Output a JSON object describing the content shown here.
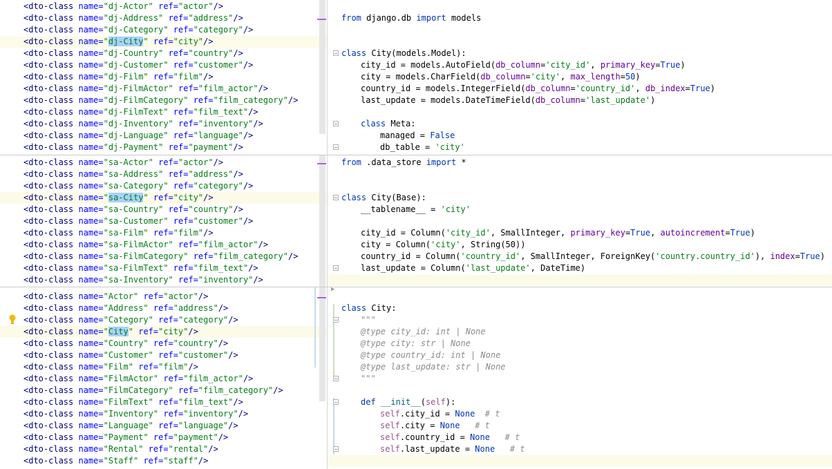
{
  "colors": {
    "selection": "#a6d2ff",
    "highlight_line": "#fcfbe8",
    "mark": "#b65dd6"
  },
  "pane1": {
    "xml_lines": [
      [
        "dj-Actor",
        "actor"
      ],
      [
        "dj-Address",
        "address"
      ],
      [
        "dj-Category",
        "category"
      ],
      [
        "dj-City",
        "city"
      ],
      [
        "dj-Country",
        "country"
      ],
      [
        "dj-Customer",
        "customer"
      ],
      [
        "dj-Film",
        "film"
      ],
      [
        "dj-FilmActor",
        "film_actor"
      ],
      [
        "dj-FilmCategory",
        "film_category"
      ],
      [
        "dj-FilmText",
        "film_text"
      ],
      [
        "dj-Inventory",
        "inventory"
      ],
      [
        "dj-Language",
        "language"
      ],
      [
        "dj-Payment",
        "payment"
      ]
    ],
    "import_from": "from",
    "import_module": "django.db",
    "import_kw": "import",
    "import_name": "models",
    "class_kw": "class",
    "class_name": "City",
    "class_base": "(models.Model):",
    "fields": [
      {
        "name": "city_id",
        "call": "models.AutoField(",
        "args": [
          [
            "db_column",
            "'city_id'"
          ],
          [
            "primary_key",
            "True"
          ]
        ]
      },
      {
        "name": "city",
        "call": "models.CharField(",
        "args": [
          [
            "db_column",
            "'city'"
          ],
          [
            "max_length",
            "50"
          ]
        ]
      },
      {
        "name": "country_id",
        "call": "models.IntegerField(",
        "args": [
          [
            "db_column",
            "'country_id'"
          ],
          [
            "db_index",
            "True"
          ]
        ]
      },
      {
        "name": "last_update",
        "call": "models.DateTimeField(",
        "args": [
          [
            "db_column",
            "'last_update'"
          ]
        ]
      }
    ],
    "meta_class": "Meta:",
    "managed_name": "managed",
    "managed_val": "False",
    "db_table_name": "db_table",
    "db_table_val": "'city'"
  },
  "pane2": {
    "xml_lines": [
      [
        "sa-Actor",
        "actor"
      ],
      [
        "sa-Address",
        "address"
      ],
      [
        "sa-Category",
        "category"
      ],
      [
        "sa-City",
        "city"
      ],
      [
        "sa-Country",
        "country"
      ],
      [
        "sa-Customer",
        "customer"
      ],
      [
        "sa-Film",
        "film"
      ],
      [
        "sa-FilmActor",
        "film_actor"
      ],
      [
        "sa-FilmCategory",
        "film_category"
      ],
      [
        "sa-FilmText",
        "film_text"
      ],
      [
        "sa-Inventory",
        "inventory"
      ]
    ],
    "import_line": "from .data_store import *",
    "class_line": "class City(Base):",
    "tablename": "__tablename__ = 'city'",
    "col_city_id": "city_id = Column('city_id', SmallInteger, primary_key=True, autoincrement=True)",
    "col_city": "city = Column('city', String(50))",
    "col_country_id": "country_id = Column('country_id', SmallInteger, ForeignKey('country.country_id'), index=True)",
    "col_last_update": "last_update = Column('last_update', DateTime)"
  },
  "pane3": {
    "xml_lines": [
      [
        "Actor",
        "actor"
      ],
      [
        "Address",
        "address"
      ],
      [
        "Category",
        "category"
      ],
      [
        "City",
        "city"
      ],
      [
        "Country",
        "country"
      ],
      [
        "Customer",
        "customer"
      ],
      [
        "Film",
        "film"
      ],
      [
        "FilmActor",
        "film_actor"
      ],
      [
        "FilmCategory",
        "film_category"
      ],
      [
        "FilmText",
        "film_text"
      ],
      [
        "Inventory",
        "inventory"
      ],
      [
        "Language",
        "language"
      ],
      [
        "Payment",
        "payment"
      ],
      [
        "Rental",
        "rental"
      ],
      [
        "Staff",
        "staff"
      ]
    ],
    "class_line": "class City:",
    "docstring_quote": "\"\"\"",
    "doc_types": [
      "@type city_id: int | None",
      "@type city: str | None",
      "@type country_id: int | None",
      "@type last_update: str | None"
    ],
    "init_def": "def __init__(self):",
    "assigns": [
      {
        "attr": ".city_id",
        "val": "None",
        "cmt": "# t",
        "pad": " "
      },
      {
        "attr": ".city",
        "val": "None",
        "cmt": "# t",
        "pad": "  "
      },
      {
        "attr": ".country_id",
        "val": "None",
        "cmt": "# t",
        "pad": "  "
      },
      {
        "attr": ".last_update",
        "val": "None",
        "cmt": "# t",
        "pad": "  "
      }
    ]
  },
  "xml_tag": "<dto-class",
  "xml_name_attr": "name=",
  "xml_ref_attr": "ref=",
  "xml_close": "/>"
}
